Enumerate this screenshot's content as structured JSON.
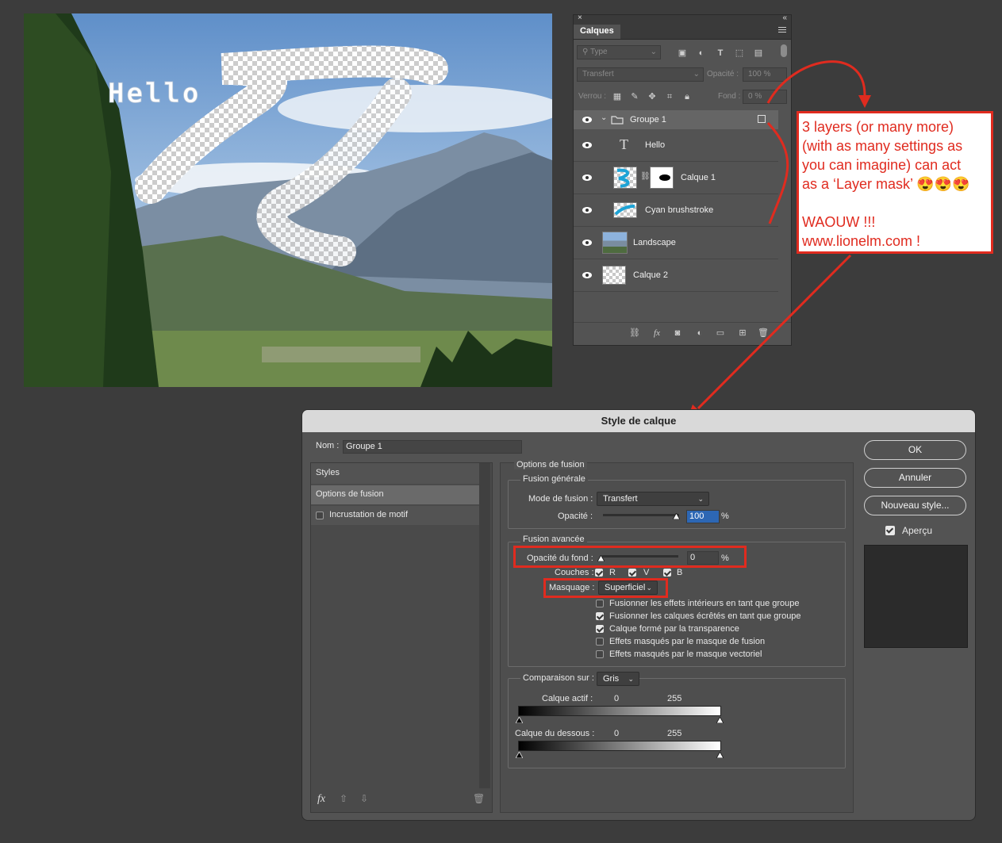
{
  "canvas": {
    "overlay_text": "Hello"
  },
  "layers_panel": {
    "tab_label": "Calques",
    "filter_placeholder": "Type",
    "blend_mode": "Transfert",
    "opacity_label": "Opacité :",
    "opacity_value": "100 %",
    "lock_label": "Verrou :",
    "fill_label": "Fond :",
    "fill_value": "0 %",
    "layers": [
      {
        "name": "Groupe 1",
        "kind": "group"
      },
      {
        "name": "Hello",
        "kind": "text"
      },
      {
        "name": "Calque 1",
        "kind": "masked"
      },
      {
        "name": "Cyan brushstroke",
        "kind": "pixel"
      },
      {
        "name": "Landscape",
        "kind": "photo"
      },
      {
        "name": "Calque 2",
        "kind": "empty"
      }
    ]
  },
  "annotation": {
    "line1": "3 layers (or many more)",
    "line2": "(with as many settings as",
    "line3": "you can imagine) can act",
    "line4": "as a ‘Layer mask’ 😍😍😍",
    "line5": "WAOUW !!!",
    "line6": "www.lionelm.com !",
    "color": "#e02b1f"
  },
  "dialog": {
    "title": "Style de calque",
    "name_label": "Nom :",
    "name_value": "Groupe 1",
    "styles_header": "Styles",
    "style_items": [
      "Options de fusion",
      "Incrustation de motif"
    ],
    "section_title": "Options de fusion",
    "general": {
      "title": "Fusion générale",
      "mode_label": "Mode de fusion :",
      "mode_value": "Transfert",
      "opacity_label": "Opacité :",
      "opacity_value": "100",
      "opacity_unit": "%"
    },
    "advanced": {
      "title": "Fusion avancée",
      "fill_label": "Opacité du fond :",
      "fill_value": "0",
      "fill_unit": "%",
      "channels_label": "Couches :",
      "channels": [
        "R",
        "V",
        "B"
      ],
      "knockout_label": "Masquage :",
      "knockout_value": "Superficiel",
      "options": [
        {
          "label": "Fusionner les effets intérieurs en tant que groupe",
          "checked": false
        },
        {
          "label": "Fusionner les calques écrêtés en tant que groupe",
          "checked": true
        },
        {
          "label": "Calque formé par la transparence",
          "checked": true
        },
        {
          "label": "Effets masqués par le masque de fusion",
          "checked": false
        },
        {
          "label": "Effets masqués par le masque vectoriel",
          "checked": false
        }
      ]
    },
    "blend_if": {
      "label": "Comparaison sur :",
      "value": "Gris",
      "this_layer_label": "Calque actif :",
      "this_min": "0",
      "this_max": "255",
      "under_label": "Calque du dessous :",
      "under_min": "0",
      "under_max": "255"
    },
    "buttons": {
      "ok": "OK",
      "cancel": "Annuler",
      "new_style": "Nouveau style...",
      "preview": "Aperçu"
    },
    "preview_checked": true
  }
}
